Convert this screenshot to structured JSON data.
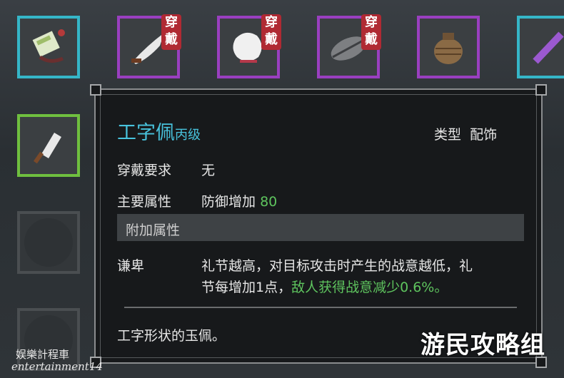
{
  "tags": {
    "wear": "穿戴"
  },
  "tooltip": {
    "name": "工字佩",
    "grade": "丙级",
    "type_label": "类型",
    "type_value": "配饰",
    "req_label": "穿戴要求",
    "req_value": "无",
    "main_label": "主要属性",
    "main_value_text": "防御增加",
    "main_value_num": "80",
    "extra_header": "附加属性",
    "extra_name": "谦卑",
    "extra_desc_line1": "礼节越高，对目标攻击时产生的战意越低，礼",
    "extra_desc_line2_a": "节每增加1点，",
    "extra_desc_line2_b": "敌人获得战意减少0.6%。",
    "flavor": "工字形状的玉佩。"
  },
  "watermarks": {
    "left_cn": "娱樂計程車",
    "left_en": "entertainment14",
    "right": "游民攻略组"
  },
  "colors": {
    "title": "#48c3dd",
    "bonus_green": "#5ec45e",
    "wear_tag": "#b02a33"
  }
}
